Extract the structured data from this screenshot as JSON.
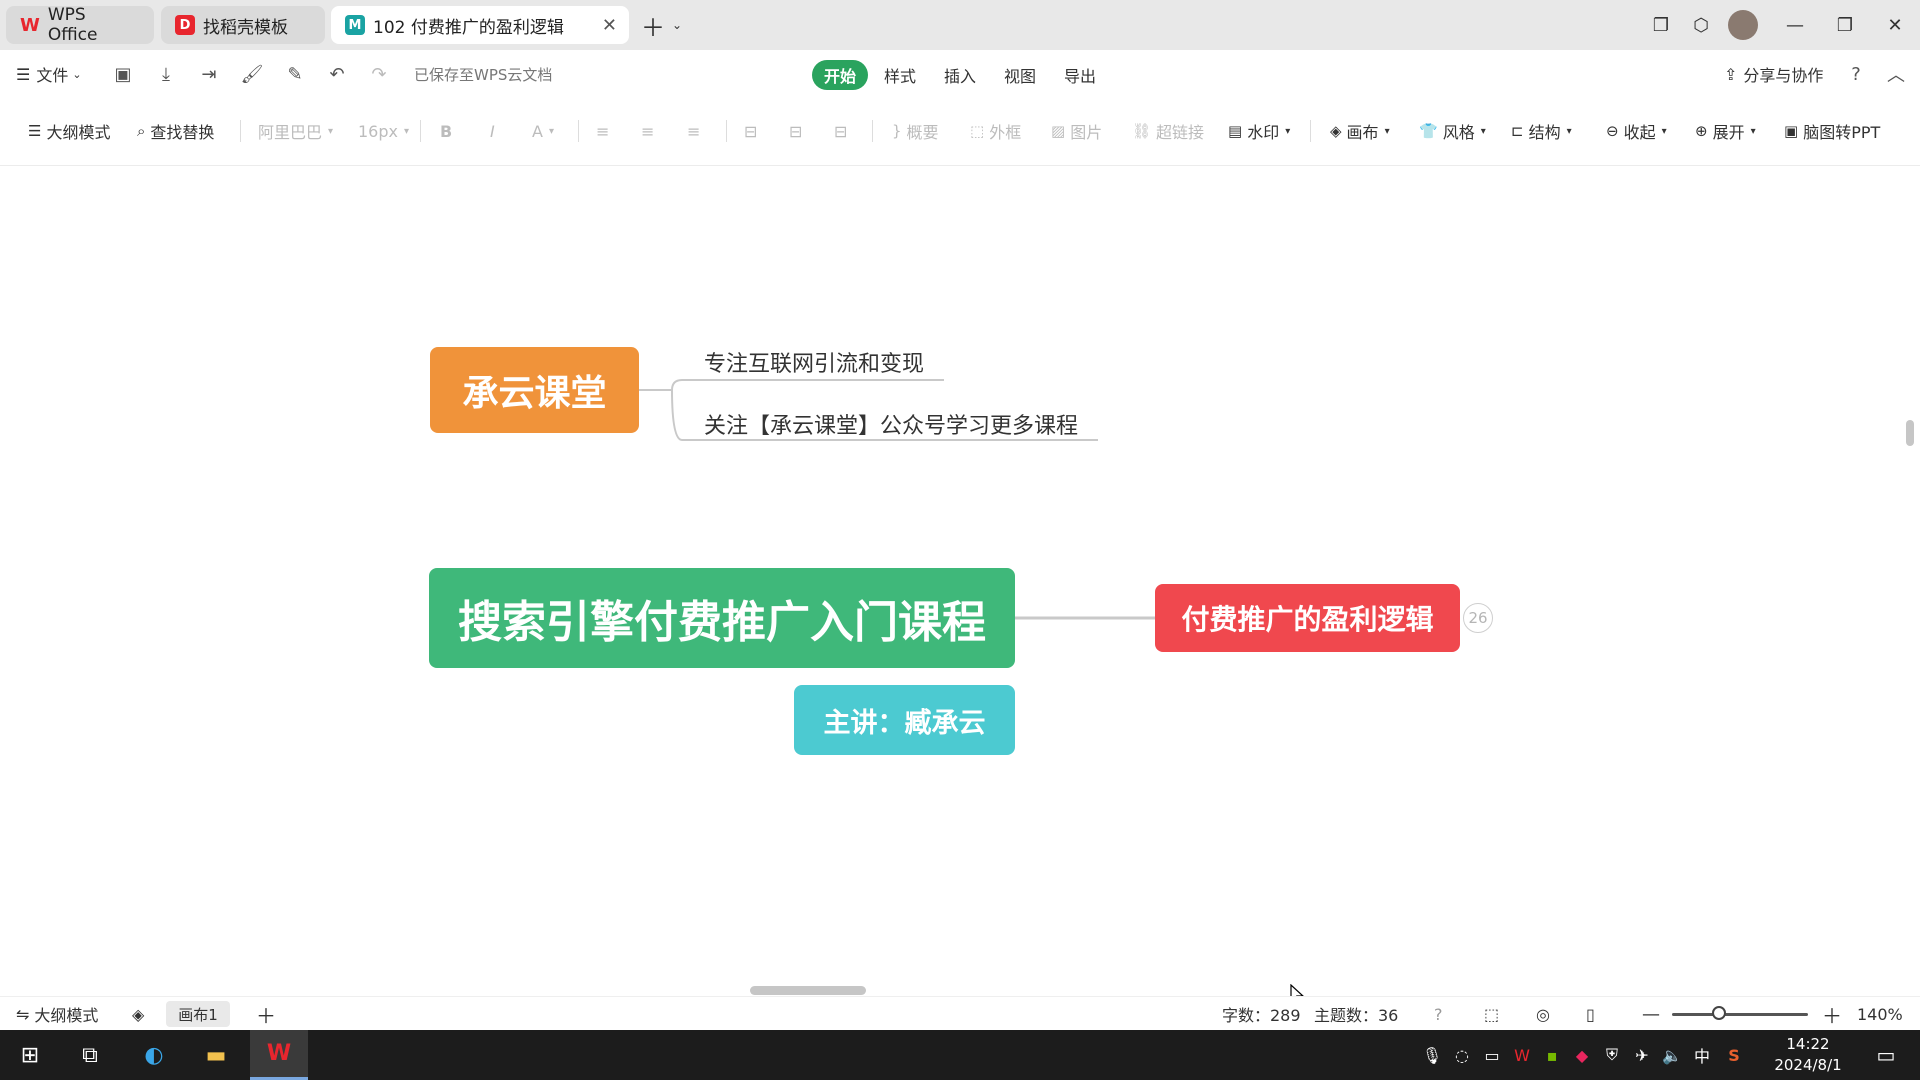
{
  "tabs": [
    {
      "label": "WPS Office",
      "icon": "wps-logo-icon",
      "active": false
    },
    {
      "label": "找稻壳模板",
      "icon": "daoke-icon",
      "active": false
    },
    {
      "label": "102 付费推广的盈利逻辑",
      "icon": "mindmap-file-icon",
      "active": true
    }
  ],
  "menu": {
    "file": "文件",
    "save_status": "已保存至WPS云文档",
    "tabs": [
      "开始",
      "样式",
      "插入",
      "视图",
      "导出"
    ],
    "share": "分享与协作"
  },
  "ribbon": {
    "outline_mode": "大纲模式",
    "find_replace": "查找替换",
    "font": "阿里巴巴",
    "font_size": "16px",
    "bold": "B",
    "italic": "I",
    "font_color": "A",
    "summary": "概要",
    "frame": "外框",
    "image": "图片",
    "hyperlink": "超链接",
    "watermark": "水印",
    "canvas": "画布",
    "style": "风格",
    "structure": "结构",
    "collapse": "收起",
    "expand": "展开",
    "to_ppt": "脑图转PPT"
  },
  "mindmap": {
    "brand_node": "承云课堂",
    "brand_children": [
      "专注互联网引流和变现",
      "关注【承云课堂】公众号学习更多课程"
    ],
    "root_node": "搜索引擎付费推广入门课程",
    "speaker_node": "主讲：臧承云",
    "branch_node": "付费推广的盈利逻辑",
    "branch_count": "26"
  },
  "statusbar": {
    "outline_mode": "大纲模式",
    "sheet": "画布1",
    "word_count": "字数：289",
    "topic_count": "主题数：36",
    "zoom": "140%"
  },
  "taskbar": {
    "ime": "中",
    "time": "14:22",
    "date": "2024/8/1"
  },
  "colors": {
    "accent_green": "#2aa35e",
    "brand_node": "#f0933a",
    "root_node": "#3fb87a",
    "speaker_node": "#4ccad1",
    "branch_node": "#f0484e"
  }
}
